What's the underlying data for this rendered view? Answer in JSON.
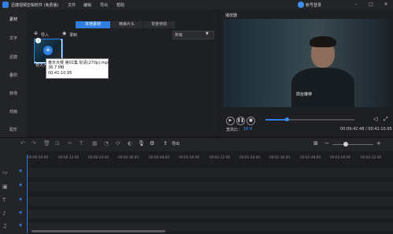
{
  "app": {
    "title": "迅捷视频剪辑软件 (免费版)",
    "menu": [
      "文件",
      "编辑",
      "导出",
      "帮助"
    ],
    "login": "帐号登录"
  },
  "sidebar": {
    "items": [
      {
        "label": "素材",
        "active": true
      },
      {
        "label": "文字"
      },
      {
        "label": "滤镜"
      },
      {
        "label": "叠附"
      },
      {
        "label": "转场"
      },
      {
        "label": "动画"
      },
      {
        "label": "配乐"
      }
    ]
  },
  "media": {
    "tabs": [
      "本地素材",
      "精美片头",
      "背景特效"
    ],
    "import_label": "导入",
    "record_label": "录制",
    "filter_value": "所有",
    "thumb_label": "春天大楼",
    "tooltip": {
      "name": "春天大楼 第01集 标清(270p).mp4",
      "size": "36.7 MB",
      "duration": "00:41:10.95"
    }
  },
  "preview": {
    "title": "播放器",
    "subtitle": "前台接待",
    "ratio_label": "宽高比：",
    "ratio_value": "16:9",
    "time": "00:09:42.48 / 00:41:10.95",
    "progress": 0.236
  },
  "toolbar": {
    "export_label": "导出"
  },
  "timeline": {
    "ticks": [
      "00:00:00.00",
      "00:00:12.00",
      "00:00:24.00",
      "00:00:36.00",
      "00:00:48.00",
      "00:01:00.00",
      "00:01:12.00",
      "00:01:24.00",
      "00:01:36.00",
      "00:01:48.00",
      "00:02:00.00",
      "00:02:12.00"
    ]
  },
  "colors": {
    "accent": "#2e7fe0",
    "background": "#1b1c1f",
    "panel": "#232427"
  }
}
